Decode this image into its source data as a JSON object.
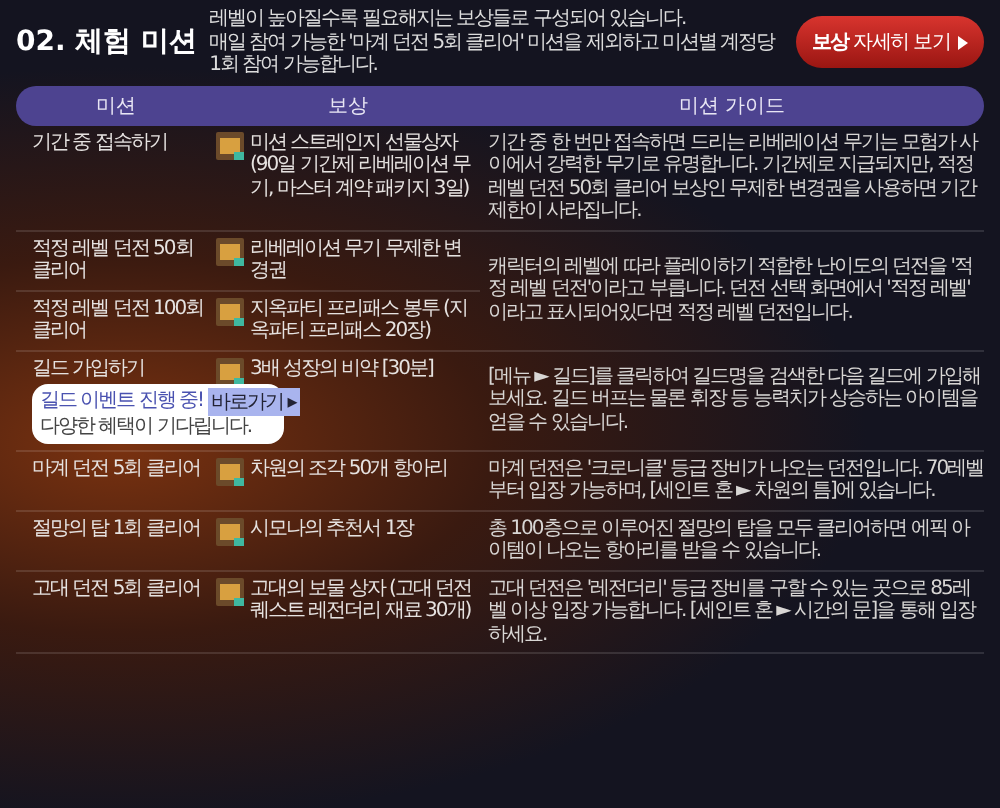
{
  "header": {
    "title": "02. 체험 미션",
    "description": [
      "레벨이 높아질수록 필요해지는 보상들로 구성되어 있습니다.",
      "매일 참여 가능한 '마계 던전 5회 클리어' 미션을 제외하고 미션별 계정당 1회 참여 가능합니다."
    ],
    "button": "**보상** 자세히 보기"
  },
  "columns": [
    "미션",
    "보상",
    "미션 가이드"
  ],
  "groups": [
    {
      "items": [
        {
          "mission": "기간 중 접속하기",
          "reward": "미션 스트레인지 선물상자 (90일 기간제 리베레이션 무기, 마스터 계약 패키지 3일)"
        }
      ],
      "guide": "기간 중 한 번만 접속하면 드리는 리베레이션 무기는 모험가 사이에서 강력한 무기로 유명합니다. 기간제로 지급되지만, 적정 레벨 던전 50회 클리어 보상인 무제한 변경권을 사용하면 기간 제한이 사라집니다."
    },
    {
      "items": [
        {
          "mission": "적정 레벨 던전 50회 클리어",
          "reward": "리베레이션 무기 무제한 변경권"
        },
        {
          "mission": "적정 레벨 던전 100회 클리어",
          "reward": "지옥파티 프리패스 봉투 (지옥파티 프리패스 20장)"
        }
      ],
      "guide": "캐릭터의 레벨에 따라 플레이하기 적합한 난이도의 던전을 '적정 레벨 던전'이라고 부릅니다. 던전 선택 화면에서 '적정 레벨' 이라고 표시되어있다면 적정 레벨 던전입니다."
    },
    {
      "items": [
        {
          "mission": "길드 가입하기",
          "reward": "3배 성장의 비약 [30분]",
          "bubble": {
            "text": "길드 이벤트 진행 중!",
            "button": "바로가기 ▸",
            "subtext": "다양한 혜택이 기다립니다."
          }
        }
      ],
      "guide": "[메뉴 ► 길드]를 클릭하여 길드명을 검색한 다음 길드에 가입해보세요. 길드 버프는 물론 휘장 등 능력치가 상승하는 아이템을 얻을 수 있습니다."
    },
    {
      "items": [
        {
          "mission": "마계 던전 5회 클리어",
          "reward": "차원의 조각 50개 항아리"
        }
      ],
      "guide": "마계 던전은 '크로니클' 등급 장비가 나오는 던전입니다. 70레벨부터 입장 가능하며, [세인트 혼 ► 차원의 틈]에 있습니다."
    },
    {
      "items": [
        {
          "mission": "절망의 탑 1회 클리어",
          "reward": "시모나의 추천서 1장"
        }
      ],
      "guide": "총 100층으로 이루어진 절망의 탑을 모두 클리어하면 에픽 아이템이 나오는 항아리를 받을 수 있습니다."
    },
    {
      "items": [
        {
          "mission": "고대 던전 5회 클리어",
          "reward": "고대의 보물 상자 (고대 던전 퀘스트 레전더리 재료 30개)"
        }
      ],
      "guide": "고대 던전은 '레전더리' 등급 장비를 구할 수 있는 곳으로 85레벨 이상 입장 가능합니다. [세인트 혼 ► 시간의 문]을 통해 입장하세요."
    }
  ]
}
